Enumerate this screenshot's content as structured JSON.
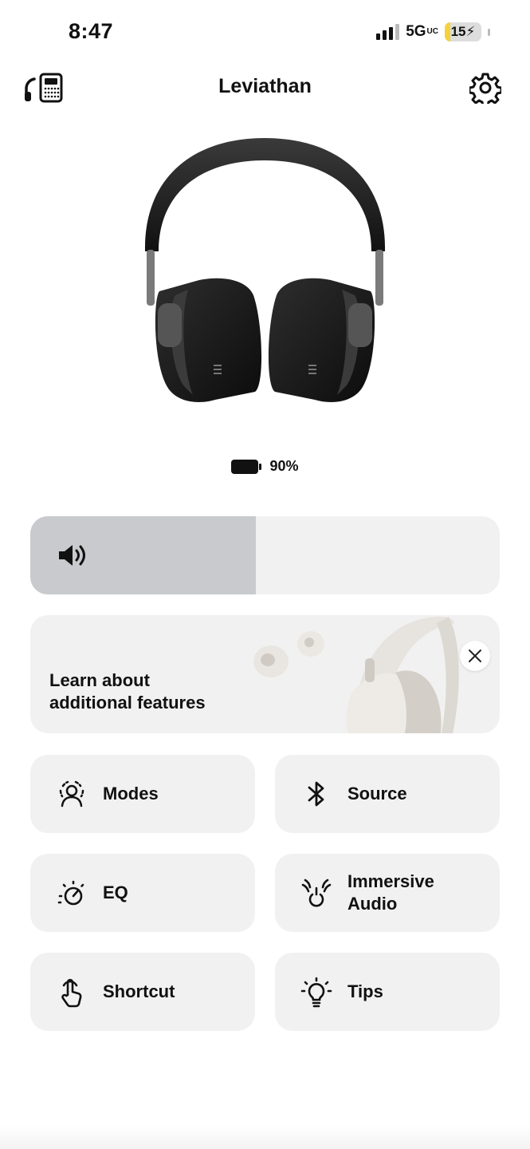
{
  "status_bar": {
    "time": "8:47",
    "network": "5G",
    "network_suffix": "UC",
    "battery": "15",
    "battery_charging": true,
    "battery_color": "#f4d23a",
    "signal_bars": 3
  },
  "header": {
    "title": "Leviathan",
    "left_icon": "headphones-device-icon",
    "right_icon": "gear-icon"
  },
  "device": {
    "battery_level": "90%"
  },
  "volume": {
    "level_fraction": 0.48,
    "icon": "speaker-icon"
  },
  "promo": {
    "text": "Learn about\nadditional features",
    "close_icon": "close-icon"
  },
  "tiles": [
    {
      "label": "Modes",
      "icon": "modes-icon"
    },
    {
      "label": "Source",
      "icon": "bluetooth-icon"
    },
    {
      "label": "EQ",
      "icon": "eq-dial-icon"
    },
    {
      "label": "Immersive\nAudio",
      "icon": "immersive-audio-icon"
    },
    {
      "label": "Shortcut",
      "icon": "touch-icon"
    },
    {
      "label": "Tips",
      "icon": "lightbulb-icon"
    }
  ]
}
